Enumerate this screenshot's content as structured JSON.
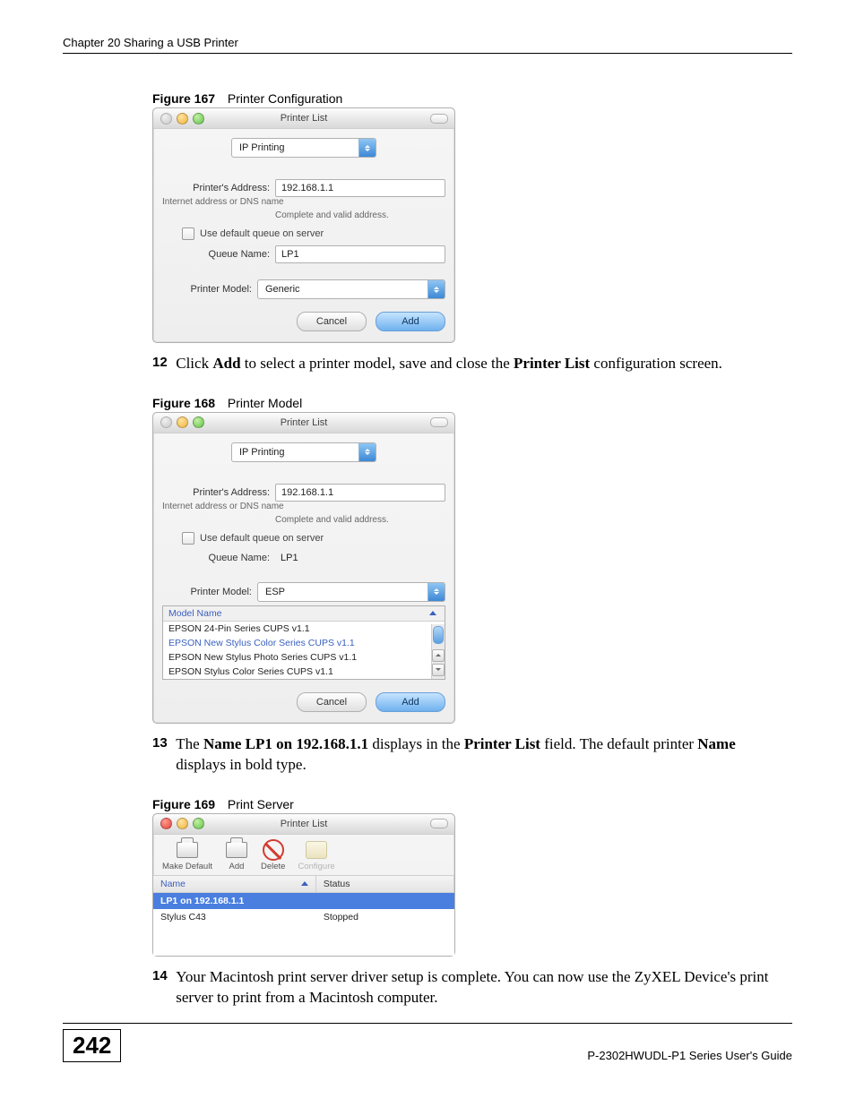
{
  "chapter_header": "Chapter 20 Sharing a USB Printer",
  "figures": {
    "f167": {
      "num": "Figure 167",
      "title": "Printer Configuration"
    },
    "f168": {
      "num": "Figure 168",
      "title": "Printer Model"
    },
    "f169": {
      "num": "Figure 169",
      "title": "Print Server"
    }
  },
  "win": {
    "title": "Printer List",
    "conn_type": "IP Printing",
    "addr_label": "Printer's Address:",
    "addr_value": "192.168.1.1",
    "addr_hint": "Internet address or DNS name",
    "addr_valid": "Complete and valid address.",
    "queue_chk": "Use default queue on server",
    "queue_label": "Queue Name:",
    "queue_value": "LP1",
    "model_label": "Printer Model:",
    "model_generic": "Generic",
    "model_esp": "ESP",
    "cancel": "Cancel",
    "add": "Add",
    "model_list_header": "Model Name",
    "models": [
      "EPSON 24-Pin Series CUPS v1.1",
      "EPSON New Stylus Color Series CUPS v1.1",
      "EPSON New Stylus Photo Series CUPS v1.1",
      "EPSON Stylus Color Series CUPS v1.1"
    ]
  },
  "toolbar": {
    "make_default": "Make Default",
    "add": "Add",
    "delete": "Delete",
    "configure": "Configure"
  },
  "list": {
    "col_name": "Name",
    "col_status": "Status",
    "row1_name": "LP1 on 192.168.1.1",
    "row1_status": "",
    "row2_name": "Stylus C43",
    "row2_status": "Stopped"
  },
  "steps": {
    "s12_num": "12",
    "s12_a": "Click ",
    "s12_b": "Add",
    "s12_c": " to select a printer model, save and close the ",
    "s12_d": "Printer List",
    "s12_e": " configuration screen.",
    "s13_num": "13",
    "s13_a": "The ",
    "s13_b": "Name LP1 on 192.168.1.1",
    "s13_c": " displays in the ",
    "s13_d": "Printer List",
    "s13_e": " field. The default printer ",
    "s13_f": "Name",
    "s13_g": " displays in bold type.",
    "s14_num": "14",
    "s14_a": "Your Macintosh print server driver setup is complete. You can now use the ZyXEL Device's print server to print from a Macintosh computer."
  },
  "footer": {
    "page": "242",
    "guide": "P-2302HWUDL-P1 Series User's Guide"
  }
}
